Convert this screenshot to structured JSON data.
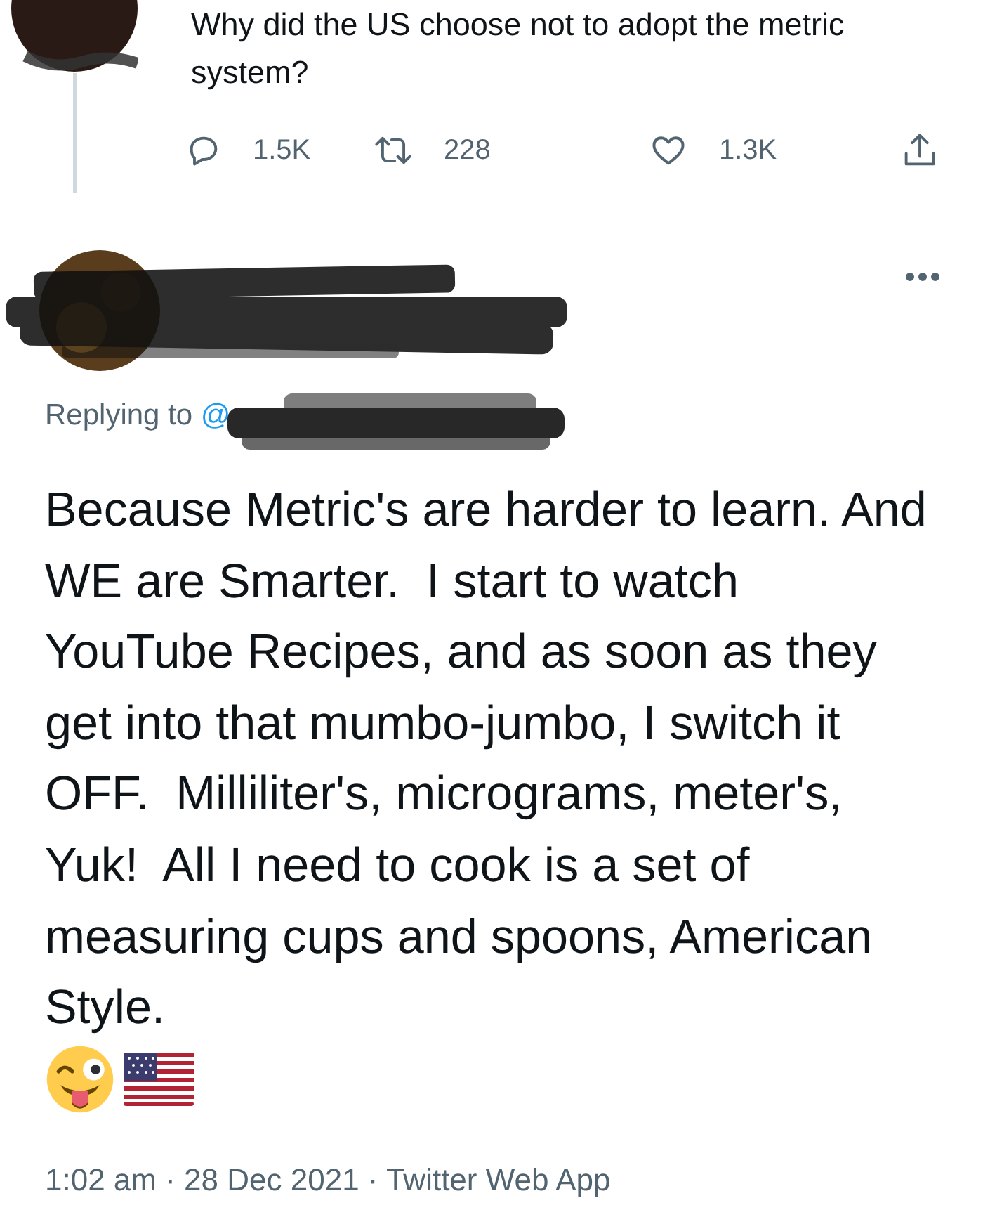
{
  "parent_tweet": {
    "text": "Why did the US choose not to adopt the metric system?",
    "actions": [
      {
        "kind": "reply",
        "count": "1.5K"
      },
      {
        "kind": "retweet",
        "count": "228"
      },
      {
        "kind": "like",
        "count": "1.3K"
      },
      {
        "kind": "share"
      }
    ]
  },
  "reply_tweet": {
    "replying_to": {
      "label": "Replying to",
      "handle": "@"
    },
    "text": "Because Metric's are harder to learn. And WE are Smarter.  I start to watch YouTube Recipes, and as soon as they get into that mumbo-jumbo, I switch it OFF.  Milliliter's, micrograms, meter's, Yuk!  All I need to cook is a set of measuring cups and spoons, American Style.",
    "emojis": [
      {
        "kind": "winking-tongue-face"
      },
      {
        "kind": "us-flag"
      }
    ],
    "timestamp": "1:02 am · 28 Dec 2021 · Twitter Web App"
  }
}
